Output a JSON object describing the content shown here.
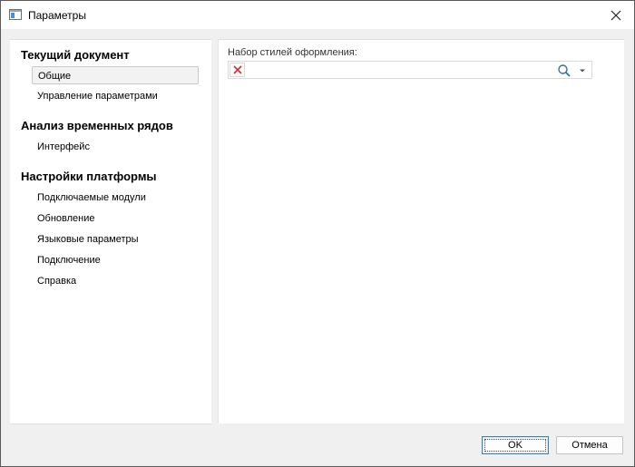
{
  "window": {
    "title": "Параметры"
  },
  "sidebar": {
    "sections": [
      {
        "title": "Текущий документ",
        "items": [
          "Общие",
          "Управление параметрами"
        ]
      },
      {
        "title": "Анализ временных рядов",
        "items": [
          "Интерфейс"
        ]
      },
      {
        "title": "Настройки платформы",
        "items": [
          "Подключаемые модули",
          "Обновление",
          "Языковые параметры",
          "Подключение",
          "Справка"
        ]
      }
    ],
    "selected": "Общие"
  },
  "main": {
    "style_set_label": "Набор стилей оформления:",
    "style_set_value": ""
  },
  "footer": {
    "ok_label": "OK",
    "cancel_label": "Отмена"
  },
  "colors": {
    "accent": "#3c7fb1",
    "clear_icon": "#d13438",
    "background": "#f0f0f0"
  }
}
